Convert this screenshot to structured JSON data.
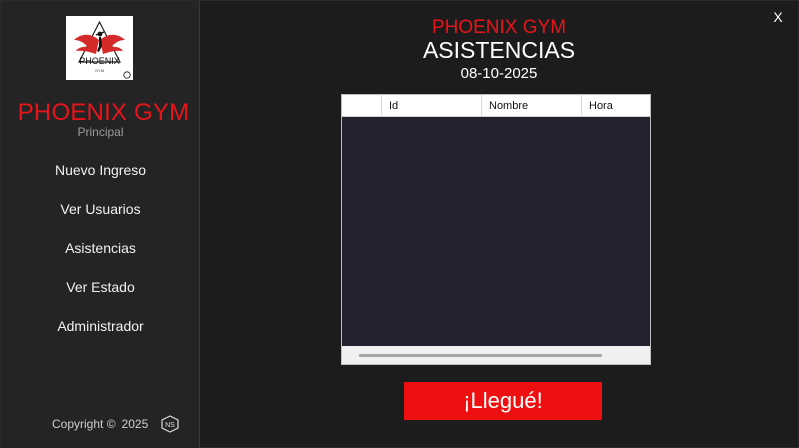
{
  "sidebar": {
    "brand_title": "PHOENIX GYM",
    "brand_subtitle": "Principal",
    "logo_text": "PHOENIX",
    "logo_subtext": "GYM",
    "items": [
      {
        "label": "Nuevo Ingreso"
      },
      {
        "label": "Ver Usuarios"
      },
      {
        "label": "Asistencias"
      },
      {
        "label": "Ver Estado"
      },
      {
        "label": "Administrador"
      }
    ],
    "footer": {
      "copyright": "Copyright ©",
      "year": "2025",
      "badge_text": "NS"
    }
  },
  "header": {
    "gym_name": "PHOENIX GYM",
    "title": "ASISTENCIAS",
    "date": "08-10-2025",
    "close_label": "X"
  },
  "table": {
    "columns": [
      "",
      "Id",
      "Nombre",
      "Hora"
    ],
    "rows": []
  },
  "action_button": {
    "label": "¡Llegué!"
  },
  "colors": {
    "accent_red": "#e8141b",
    "button_red": "#ee1010",
    "sidebar_bg": "#242424",
    "main_bg": "#1c1c1c",
    "grid_bg": "#22232f"
  }
}
